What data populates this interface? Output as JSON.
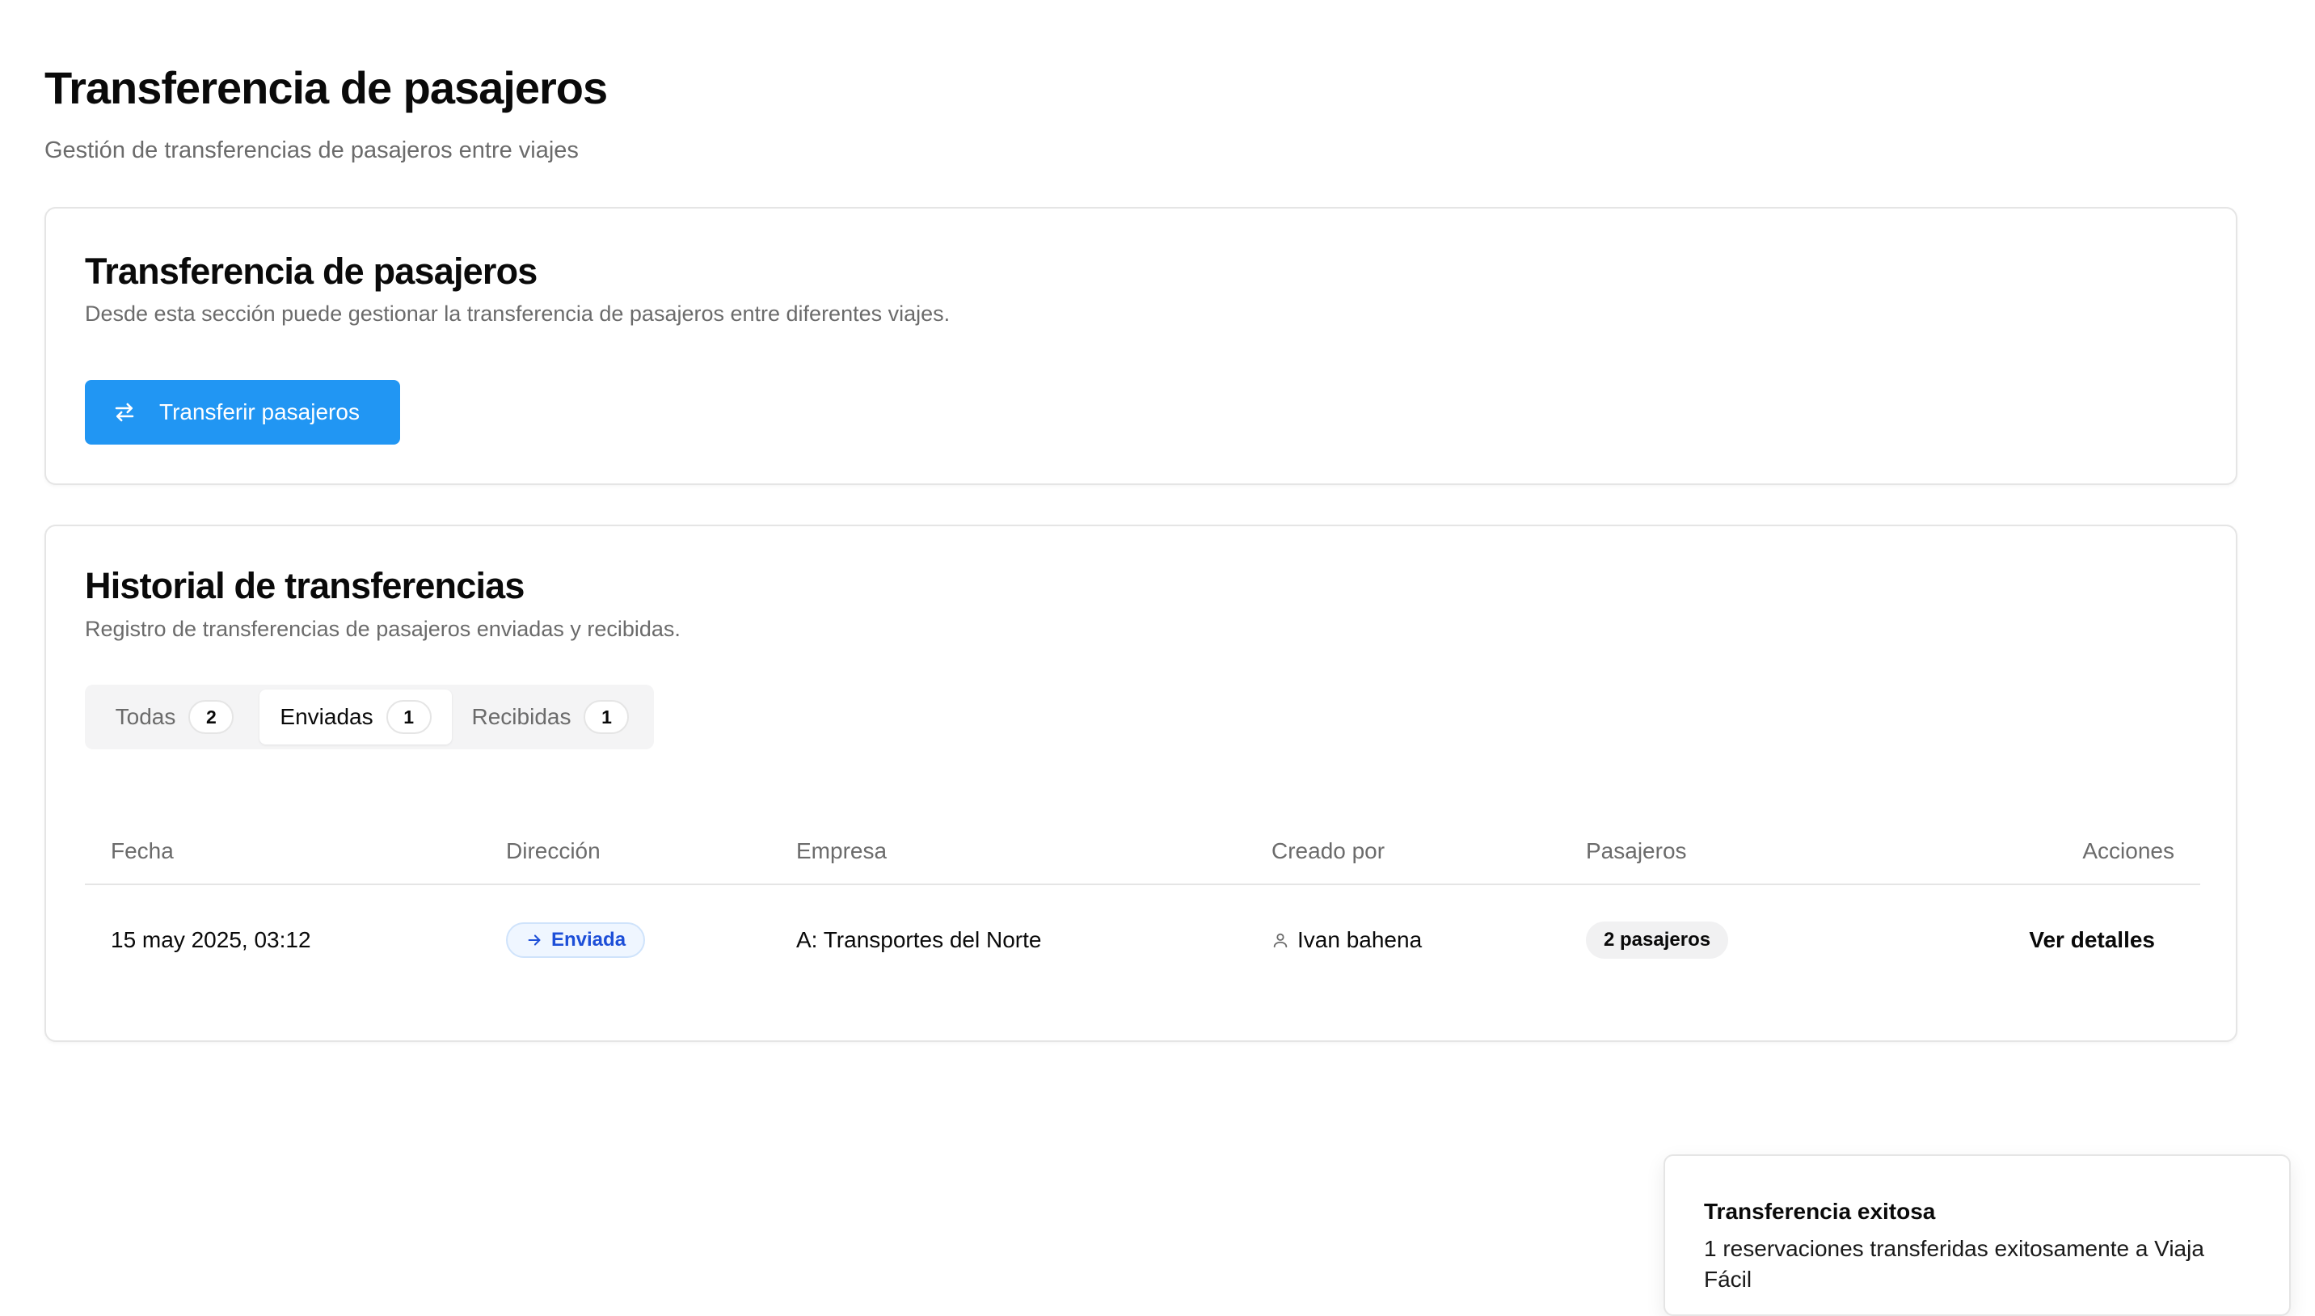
{
  "page": {
    "title": "Transferencia de pasajeros",
    "subtitle": "Gestión de transferencias de pasajeros entre viajes"
  },
  "transfer_card": {
    "title": "Transferencia de pasajeros",
    "description": "Desde esta sección puede gestionar la transferencia de pasajeros entre diferentes viajes.",
    "button_label": "Transferir pasajeros",
    "button_icon": "arrows-left-right-icon"
  },
  "history_card": {
    "title": "Historial de transferencias",
    "description": "Registro de transferencias de pasajeros enviadas y recibidas.",
    "tabs": [
      {
        "label": "Todas",
        "count": "2",
        "active": false
      },
      {
        "label": "Enviadas",
        "count": "1",
        "active": true
      },
      {
        "label": "Recibidas",
        "count": "1",
        "active": false
      }
    ],
    "table": {
      "columns": [
        "Fecha",
        "Dirección",
        "Empresa",
        "Creado por",
        "Pasajeros",
        "Acciones"
      ],
      "rows": [
        {
          "fecha": "15 may 2025, 03:12",
          "direccion": "Enviada",
          "direccion_icon": "arrow-right-icon",
          "empresa": "A: Transportes del Norte",
          "creado_por": "Ivan bahena",
          "creado_por_icon": "user-icon",
          "pasajeros": "2 pasajeros",
          "accion": "Ver detalles"
        }
      ]
    }
  },
  "toast": {
    "title": "Transferencia exitosa",
    "message": "1 reservaciones transferidas exitosamente a Viaja Fácil"
  },
  "colors": {
    "primary": "#2196f3",
    "direction_badge_text": "#1d4fd8",
    "direction_badge_bg": "#eff6ff",
    "muted_text": "#6b6b6b",
    "border": "#e5e5e5"
  }
}
